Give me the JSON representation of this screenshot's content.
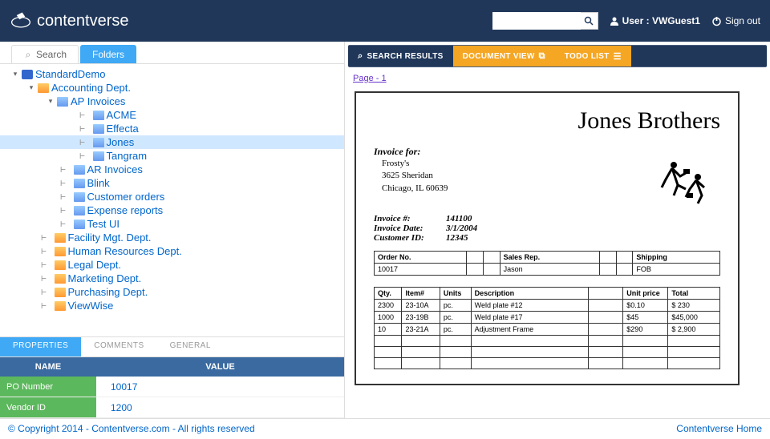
{
  "header": {
    "brand": "contentverse",
    "search_placeholder": "",
    "user_label": "User : VWGuest1",
    "signout": "Sign out"
  },
  "left_tabs": {
    "search": "Search",
    "folders": "Folders"
  },
  "tree": {
    "root": "StandardDemo",
    "accounting": "Accounting Dept.",
    "ap_invoices": "AP Invoices",
    "acme": "ACME",
    "effecta": "Effecta",
    "jones": "Jones",
    "tangram": "Tangram",
    "ar_invoices": "AR Invoices",
    "blink": "Blink",
    "customer_orders": "Customer orders",
    "expense_reports": "Expense reports",
    "test_ui": "Test UI",
    "facility": "Facility Mgt. Dept.",
    "hr": "Human Resources Dept.",
    "legal": "Legal Dept.",
    "marketing": "Marketing Dept.",
    "purchasing": "Purchasing Dept.",
    "viewwise": "ViewWise"
  },
  "prop_tabs": {
    "properties": "PROPERTIES",
    "comments": "COMMENTS",
    "general": "GENERAL"
  },
  "prop_header": {
    "name": "NAME",
    "value": "VALUE"
  },
  "properties": [
    {
      "name": "PO Number",
      "value": "10017"
    },
    {
      "name": "Vendor ID",
      "value": "1200"
    }
  ],
  "right_tabs": {
    "search_results": "SEARCH RESULTS",
    "document_view": "DOCUMENT VIEW",
    "todo_list": "TODO LIST"
  },
  "page_link": "Page - 1",
  "document": {
    "title": "Jones Brothers",
    "invoice_for_label": "Invoice for:",
    "addr1": "Frosty's",
    "addr2": "3625 Sheridan",
    "addr3": "Chicago, IL 60639",
    "meta": [
      {
        "label": "Invoice #:",
        "value": "141100"
      },
      {
        "label": "Invoice Date:",
        "value": "3/1/2004"
      },
      {
        "label": "Customer ID:",
        "value": "12345"
      }
    ],
    "order_headers": [
      "Order No.",
      "",
      "",
      "Sales Rep.",
      "",
      "",
      "Shipping"
    ],
    "order_row": [
      "10017",
      "",
      "",
      "Jason",
      "",
      "",
      "FOB"
    ],
    "line_headers": [
      "Qty.",
      "Item#",
      "Units",
      "Description",
      "",
      "Unit price",
      "Total"
    ],
    "lines": [
      [
        "2300",
        "23-10A",
        "pc.",
        "Weld plate #12",
        "",
        "$0.10",
        "$    230"
      ],
      [
        "1000",
        "23-19B",
        "pc.",
        "Weld plate #17",
        "",
        "$45",
        "$45,000"
      ],
      [
        "10",
        "23-21A",
        "pc.",
        "Adjustment Frame",
        "",
        "$290",
        "$  2,900"
      ]
    ]
  },
  "footer": {
    "copyright": "© Copyright 2014 - Contentverse.com - All rights reserved",
    "home": "Contentverse Home"
  }
}
